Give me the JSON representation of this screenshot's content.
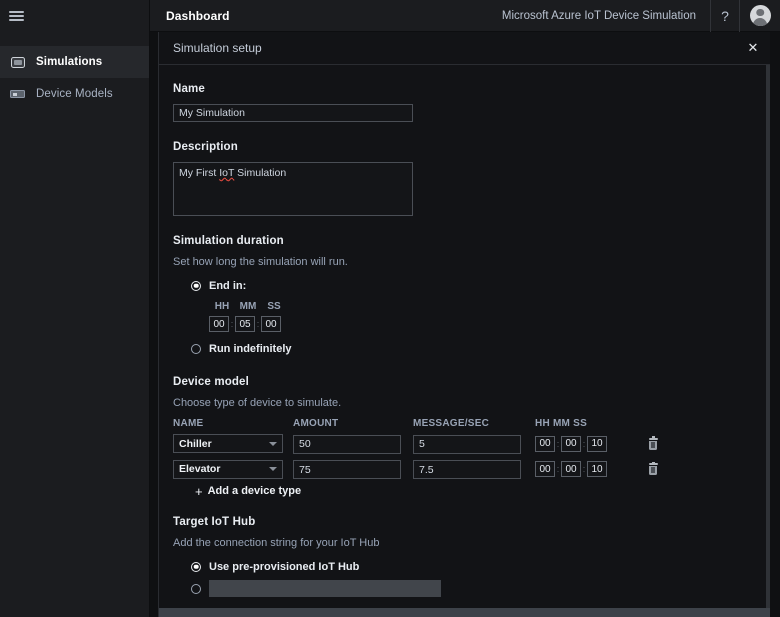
{
  "sidebar": {
    "menu_icon": "hamburger-icon",
    "items": [
      {
        "label": "Simulations",
        "icon": "simulation-device-icon",
        "active": true
      },
      {
        "label": "Device Models",
        "icon": "device-model-icon",
        "active": false
      }
    ]
  },
  "topbar": {
    "title": "Dashboard",
    "brand": "Microsoft Azure IoT Device Simulation",
    "help_icon": "question-mark-icon",
    "help_label": "?",
    "avatar_icon": "user-avatar-icon"
  },
  "panel": {
    "title": "Simulation setup",
    "close_icon": "close-icon",
    "close_label": "✕"
  },
  "form": {
    "name": {
      "label": "Name",
      "value": "My Simulation",
      "placeholder": "Name"
    },
    "description": {
      "label": "Description",
      "value": "My First IoT Simulation",
      "value_pre": "My First ",
      "value_misspelled": "IoT",
      "value_post": " Simulation",
      "placeholder": "Description"
    },
    "duration": {
      "title": "Simulation duration",
      "subtitle": "Set how long the simulation will run.",
      "end_in_label": "End in:",
      "end_in_selected": true,
      "hh_label": "HH",
      "mm_label": "MM",
      "ss_label": "SS",
      "hh": "00",
      "mm": "05",
      "ss": "00",
      "colon": ":",
      "run_indefinitely_label": "Run indefinitely",
      "run_indefinitely_selected": false
    },
    "device_model": {
      "title": "Device model",
      "subtitle": "Choose type of device to simulate.",
      "columns": {
        "name": "NAME",
        "amount": "AMOUNT",
        "message_sec": "MESSAGE/SEC",
        "hms": "HH MM SS"
      },
      "rows": [
        {
          "name": "Chiller",
          "amount": "50",
          "message_sec": "5",
          "hh": "00",
          "mm": "00",
          "ss": "10",
          "delete_icon": "trash-icon"
        },
        {
          "name": "Elevator",
          "amount": "75",
          "message_sec": "7.5",
          "hh": "00",
          "mm": "00",
          "ss": "10",
          "delete_icon": "trash-icon"
        }
      ],
      "add_label": "Add a device type",
      "add_icon": "plus-icon",
      "add_icon_glyph": "+",
      "colon": ":"
    },
    "target_hub": {
      "title": "Target IoT Hub",
      "subtitle": "Add the connection string for your IoT Hub",
      "preprovisioned_label": "Use pre-provisioned IoT Hub",
      "preprovisioned_selected": true,
      "custom_selected": false,
      "custom_value": ""
    }
  },
  "colors": {
    "panel_bg": "#121316",
    "sidebar_bg": "#1b1c1f",
    "topbar_bg": "#1b1c1f",
    "page_bg": "#0f1012",
    "text_primary": "#e9edf2",
    "text_muted": "#97a3b6",
    "input_border": "#4a4e55",
    "footer_bar": "#3d4249",
    "spellcheck_underline": "#e04a3f"
  }
}
